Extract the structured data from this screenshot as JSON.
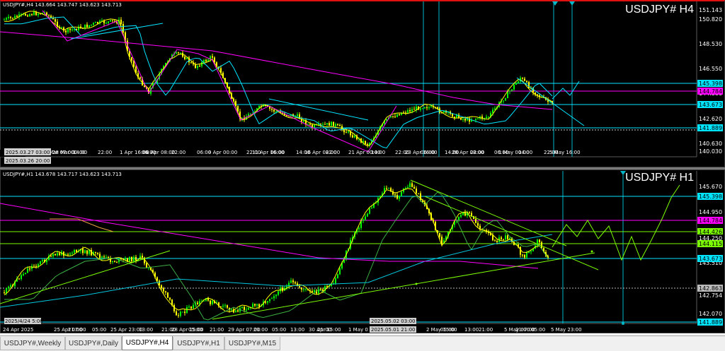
{
  "pane_top": {
    "info": "USDJPY#,H4  143.664 143.747 143.623 143.713",
    "symbol_label": "USDJPY# H4",
    "price_labels": [
      "151.143",
      "150.820",
      "148.530",
      "146.550",
      "144.580",
      "142.620",
      "140.630",
      "140.030"
    ],
    "level_tags": [
      {
        "text": "145.398",
        "bg": "#00e5ff",
        "fg": "#000"
      },
      {
        "text": "144.784",
        "bg": "#ff00ff",
        "fg": "#000"
      },
      {
        "text": "143.673",
        "bg": "#00e5ff",
        "fg": "#000"
      },
      {
        "text": "141.889",
        "bg": "#00e5ff",
        "fg": "#000"
      }
    ],
    "time_labels": [
      "27 Mar 07:00",
      "28 Mar 00:00",
      "14:00",
      "22:00",
      "1 Apr 16:00",
      "06:00",
      "4 Apr 08:00",
      "22:00",
      "06:00",
      "9 Apr 00:00",
      "22:00",
      "11 Apr 16:00",
      "06:00",
      "14:00",
      "16 Apr 08:00",
      "22:00",
      "21 Apr 00:00",
      "14:00",
      "22:00",
      "23 Apr 16:00",
      "06:00",
      "14:00",
      "28 Apr 08:00",
      "22:00",
      "06:00",
      "1 May 00:00",
      "14:00",
      "22:00",
      "5 May 16:00"
    ],
    "time_highlights": [
      "2025.03.27 03:00",
      "2025.03.26 20:00"
    ]
  },
  "pane_bottom": {
    "info": "USDJPY#,H1  143.678 143.717 143.623 143.713",
    "symbol_label": "USDJPY# H1",
    "price_labels": [
      "145.670",
      "144.950",
      "144.230",
      "143.510",
      "142.790",
      "142.070"
    ],
    "level_tags": [
      {
        "text": "145.398",
        "bg": "#00e5ff",
        "fg": "#000"
      },
      {
        "text": "144.784",
        "bg": "#ff00ff",
        "fg": "#000"
      },
      {
        "text": "144.426",
        "bg": "#7cfc00",
        "fg": "#000"
      },
      {
        "text": "144.250",
        "bg": "#000",
        "fg": "#fff"
      },
      {
        "text": "144.115",
        "bg": "#7cfc00",
        "fg": "#000"
      },
      {
        "text": "143.673",
        "bg": "#00e5ff",
        "fg": "#000"
      },
      {
        "text": "142.863",
        "bg": "#bbbbbb",
        "fg": "#000"
      },
      {
        "text": "142.754",
        "bg": "#000",
        "fg": "#fff"
      },
      {
        "text": "141.889",
        "bg": "#00e5ff",
        "fg": "#000"
      }
    ],
    "time_labels": [
      "24 Apr 2025",
      "25 Apr 07:00",
      "21:00",
      "05:00",
      "25 Apr 23:00",
      "13:00",
      "21:00",
      "28 Apr 15:00",
      "05:00",
      "21:00",
      "29 Apr 07:00",
      "21:00",
      "05:00",
      "13:00",
      "30 Apr 15:00",
      "21:00",
      "1 May 0",
      "13:00",
      "21:00",
      "2 May 15:00",
      "05:00",
      "13:00",
      "21:00",
      "5 May 07:00",
      "21:00",
      "05:00",
      "5 May 23:00"
    ],
    "time_highlights": [
      "2025/4/24 5:00",
      "2025.05.02 03:00",
      "2025.05.01 21:00"
    ]
  },
  "tabs": [
    "USDJPY#,Weekly",
    "USDJPY#,Daily",
    "USDJPY#,H4",
    "USDJPY#,H1",
    "USDJPY#,M15"
  ],
  "active_tab": "USDJPY#,H4",
  "colors": {
    "background": "#000000",
    "candle_bull": "#00ff00",
    "candle_bear": "#ffff00",
    "ma_fast": "#ffff00",
    "ma_slow": "#00e5ff",
    "ma_long": "#ff00ff",
    "trend": "#7cfc00",
    "level": "#00e5ff",
    "frame_top": "#e01010"
  }
}
